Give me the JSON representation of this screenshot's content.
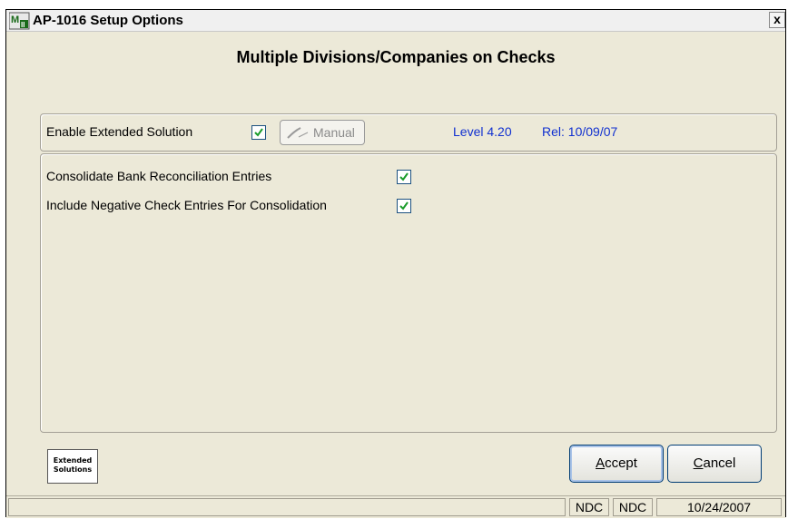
{
  "window": {
    "title": "AP-1016 Setup Options",
    "close_glyph": "x"
  },
  "header": {
    "title": "Multiple Divisions/Companies on Checks"
  },
  "extended": {
    "label": "Enable Extended Solution",
    "checked": true,
    "manual_button": "Manual",
    "level": "Level 4.20",
    "release": "Rel: 10/09/07"
  },
  "options": [
    {
      "label": "Consolidate Bank Reconciliation Entries",
      "checked": true
    },
    {
      "label": "Include Negative Check Entries For Consolidation",
      "checked": true
    }
  ],
  "logo": {
    "line1": "Extended",
    "line2": "Solutions"
  },
  "buttons": {
    "accept": "Accept",
    "cancel": "Cancel"
  },
  "status": {
    "cell1": "NDC",
    "cell2": "NDC",
    "date": "10/24/2007"
  },
  "colors": {
    "accent_blue": "#1030d0",
    "check_green": "#1a9c2a"
  },
  "icons": {
    "app": "mas90-icon",
    "check": "checkmark-icon",
    "manual": "pen-icon",
    "close": "close-icon"
  }
}
